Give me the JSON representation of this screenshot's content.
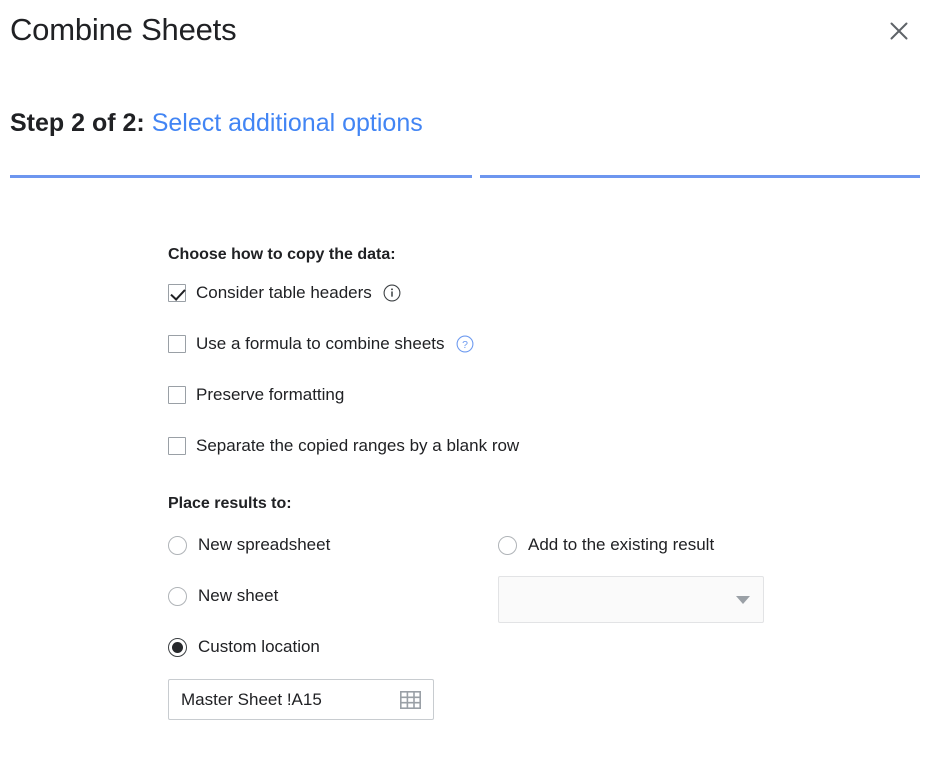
{
  "header": {
    "title": "Combine Sheets",
    "close_icon": "close-icon"
  },
  "step": {
    "label": "Step 2 of 2:",
    "subtitle": "Select additional options",
    "current": 2,
    "total": 2,
    "accent_color": "#4285F4",
    "progress_color": "#6d96ef"
  },
  "copy_section": {
    "heading": "Choose how to copy the data:",
    "options": [
      {
        "label": "Consider table headers",
        "checked": true,
        "hint": "info-icon"
      },
      {
        "label": "Use a formula to combine sheets",
        "checked": false,
        "hint": "help-icon"
      },
      {
        "label": "Preserve formatting",
        "checked": false,
        "hint": null
      },
      {
        "label": "Separate the copied ranges by a blank row",
        "checked": false,
        "hint": null
      }
    ]
  },
  "place_section": {
    "heading": "Place results to:",
    "left_options": [
      {
        "label": "New spreadsheet",
        "selected": false
      },
      {
        "label": "New sheet",
        "selected": false
      },
      {
        "label": "Custom location",
        "selected": true
      }
    ],
    "right_options": [
      {
        "label": "Add to the existing result",
        "selected": false
      }
    ],
    "existing_result_dropdown": {
      "value": "",
      "placeholder": "",
      "disabled": true,
      "arrow_icon": "chevron-down-icon"
    },
    "custom_location_input": {
      "value": "Master Sheet !A15",
      "picker_icon": "range-picker-icon"
    }
  }
}
